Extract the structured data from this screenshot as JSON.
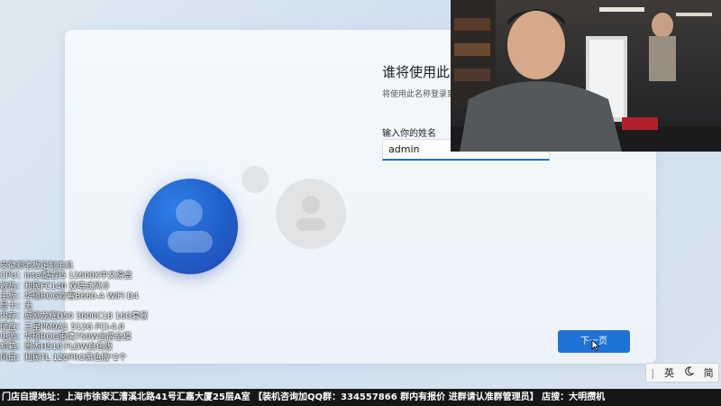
{
  "oobe": {
    "title": "谁将使用此",
    "subtitle": "将使用此名称登录到",
    "name_label": "输入你的姓名",
    "name_value": "admin",
    "next_label": "下一页"
  },
  "specs": [
    "安徽郑老板定制主机",
    "CPU：intel酷睿i5 12600K中文原盒",
    "散热：利民FC140 双塔式风冷",
    "主板：华硕ROG吹雪B660-A WIFI D4",
    "显卡：无",
    "内存：威刚龙耀D50 3600C18 16G套餐",
    "硬盘：三星PM9A1 512G PCI-4.0",
    "电源：华硕ROG雷鹰750W金牌全模",
    "机箱：恩杰H510 FLOW白色版",
    "风扇：利民TL 120PRO黑色版*2个"
  ],
  "banner": "门店自提地址：上海市徐家汇漕溪北路41号汇嘉大厦25层A室 【装机咨询加QQ群：334557866 群内有报价 进群请认准群管理员】 店搜：大明攒机",
  "ime": {
    "mode_label": "英",
    "width_icon": "moon-icon",
    "script_label": "简"
  },
  "colors": {
    "accent": "#1f72d6",
    "avatar": "#1f5fc8"
  }
}
